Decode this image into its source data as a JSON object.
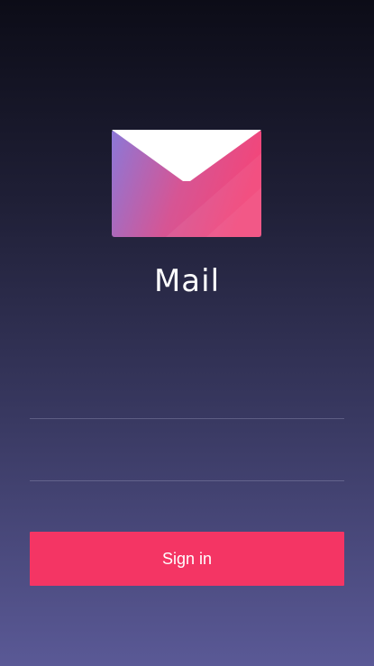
{
  "app": {
    "title": "Mail",
    "logo_icon": "envelope-icon"
  },
  "form": {
    "username_placeholder": "",
    "password_placeholder": "",
    "signin_label": "Sign in"
  },
  "colors": {
    "background_top": "#0c0c17",
    "background_bottom": "#5a5996",
    "accent": "#f43564",
    "envelope_gradient_start": "#8b78d8",
    "envelope_gradient_end": "#f2467a"
  }
}
